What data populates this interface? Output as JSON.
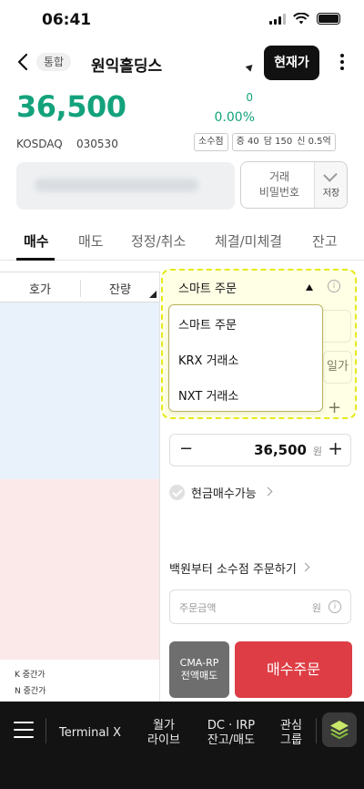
{
  "status_bar": {
    "time": "06:41"
  },
  "header": {
    "market_tag": "통합",
    "stock_name": "원익홀딩스",
    "current_price_button": "현재가"
  },
  "quote": {
    "price": "36,500",
    "change": "0",
    "change_pct": "0.00%",
    "market": "KOSDAQ",
    "code": "030530",
    "chip_decimal": "소수점",
    "chip_margin_1": "증 40",
    "chip_margin_2": "담 150",
    "chip_margin_3": "신 0.5억"
  },
  "account": {
    "password_line1": "거래",
    "password_line2": "비밀번호",
    "save_label": "저장"
  },
  "tabs": [
    {
      "label": "매수",
      "active": true
    },
    {
      "label": "매도",
      "active": false
    },
    {
      "label": "정정/취소",
      "active": false
    },
    {
      "label": "체결/미체결",
      "active": false
    },
    {
      "label": "잔고",
      "active": false
    }
  ],
  "orderbook": {
    "col_price": "호가",
    "col_volume": "잔량",
    "footer_1": "K 중간가",
    "footer_2": "N 중간가"
  },
  "order": {
    "route_selected": "스마트 주문",
    "route_options": [
      "스마트 주문",
      "KRX 거래소",
      "NXT 거래소"
    ],
    "side_button_fragment": "일가",
    "price_value": "36,500",
    "price_unit": "원",
    "cash_buy_label": "현금매수가능",
    "fractional_label": "백원부터 소수점 주문하기",
    "amount_placeholder": "주문금액",
    "amount_unit": "원",
    "cma_line1": "CMA-RP",
    "cma_line2": "전액매도",
    "buy_button": "매수주문"
  },
  "bottom_nav": {
    "terminal": "Terminal X",
    "monthly_line1": "월가",
    "monthly_line2": "라이브",
    "dc_line1": "DC · IRP",
    "dc_line2": "잔고/매도",
    "group_line1": "관심",
    "group_line2": "그룹"
  },
  "colors": {
    "price_up_flat": "#13a27c",
    "buy_button": "#de3d45",
    "ask_bg": "#e9f1fb",
    "bid_bg": "#fbe9ea",
    "highlight_dashed": "#e6ea1a"
  }
}
